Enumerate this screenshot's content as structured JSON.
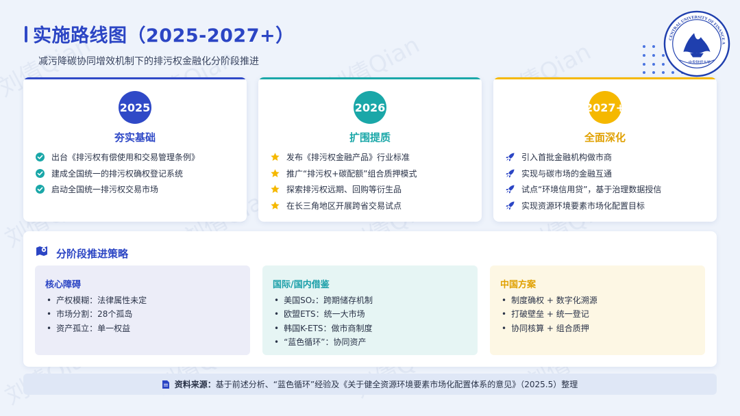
{
  "header": {
    "title": "实施路线图（2025-2027+）",
    "subtitle": "减污降碳协同增效机制下的排污权金融化分阶段推进"
  },
  "logo": {
    "seal_text": "CENTRAL UNIVERSITY OF FINANCE AND ECONOMICS",
    "name_cn": "中央财经大学"
  },
  "watermark": "刘倩Qian",
  "phases": [
    {
      "year": "2025",
      "title": "夯实基础",
      "accent": "#2f49c7",
      "icon": "check-circle-icon",
      "items": [
        "出台《排污权有偿使用和交易管理条例》",
        "建成全国统一的排污权确权登记系统",
        "启动全国统一排污权交易市场"
      ]
    },
    {
      "year": "2026",
      "title": "扩围提质",
      "accent": "#1aa7a8",
      "icon": "star-icon",
      "items": [
        "发布《排污权金融产品》行业标准",
        "推广“排污权+碳配额”组合质押模式",
        "探索排污权远期、回购等衍生品",
        "在长三角地区开展跨省交易试点"
      ]
    },
    {
      "year": "2027+",
      "title": "全面深化",
      "accent": "#f5b800",
      "icon": "rocket-icon",
      "items": [
        "引入首批金融机构做市商",
        "实现与碳市场的金融互通",
        "试点“环境信用贷”，基于治理数据授信",
        "实现资源环境要素市场化配置目标"
      ]
    }
  ],
  "strategy": {
    "title": "分阶段推进策略",
    "boxes": [
      {
        "title": "核心障碍",
        "color": "#2b45c4",
        "bg": "#ecedf8",
        "items": [
          "产权模糊：法律属性未定",
          "市场分割：28个孤岛",
          "资产孤立：单一权益"
        ]
      },
      {
        "title": "国际/国内借鉴",
        "color": "#1a9fa8",
        "bg": "#e6f5f4",
        "items": [
          "美国SO₂：跨期储存机制",
          "欧盟ETS：统一大市场",
          "韩国K-ETS：做市商制度",
          "“蓝色循环”：协同资产"
        ]
      },
      {
        "title": "中国方案",
        "color": "#e0a000",
        "bg": "#fdf7e4",
        "items": [
          "制度确权 + 数字化溯源",
          "打破壁垒 + 统一登记",
          "协同核算 + 组合质押"
        ]
      }
    ]
  },
  "footer": {
    "label": "资料来源：",
    "text": "基于前述分析、“蓝色循环”经验及《关于健全资源环境要素市场化配置体系的意见》（2025.5）整理"
  }
}
